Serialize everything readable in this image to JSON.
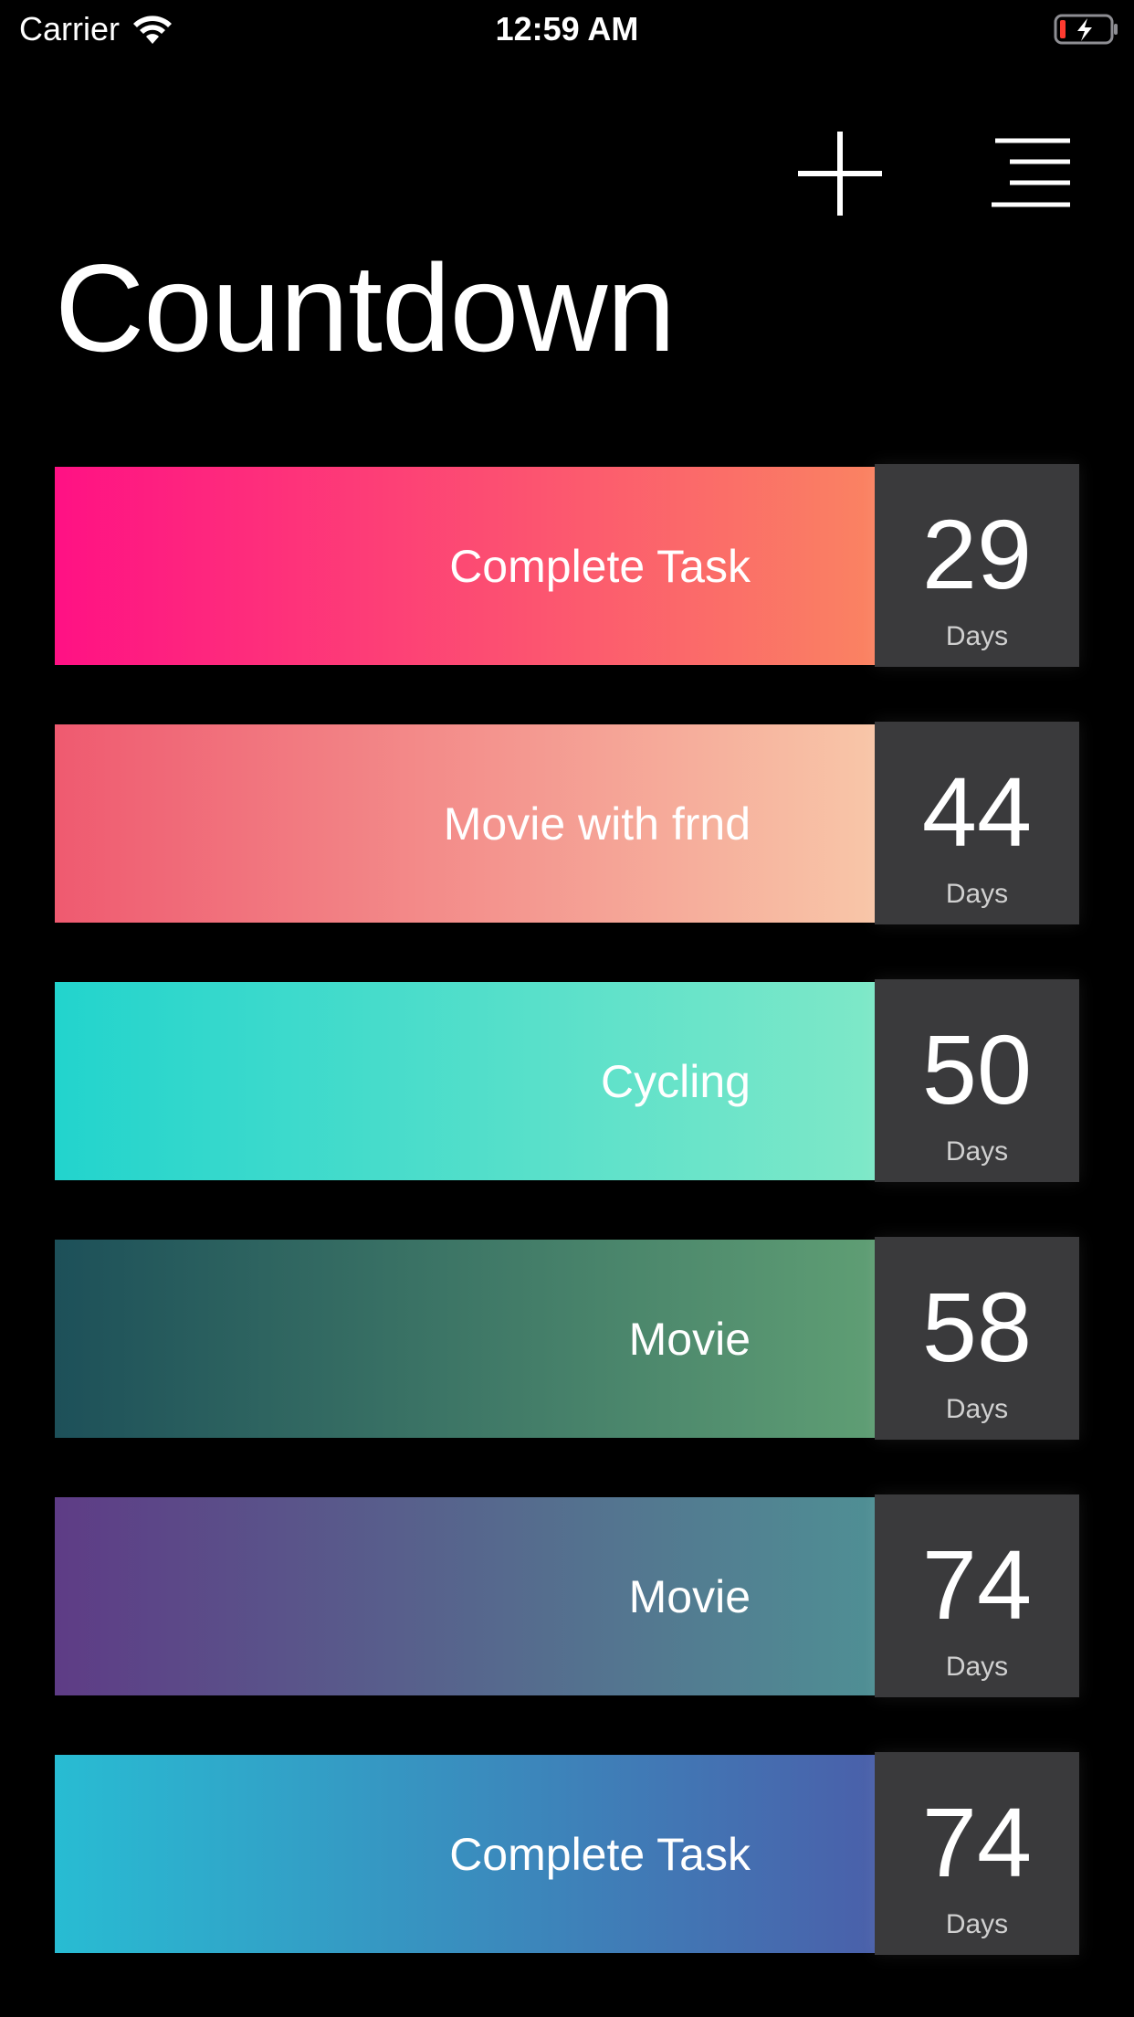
{
  "status_bar": {
    "carrier": "Carrier",
    "time": "12:59 AM",
    "icons": [
      "wifi-icon",
      "battery-charging-icon"
    ]
  },
  "toolbar": {
    "add_icon": "plus-icon",
    "menu_icon": "menu-icon"
  },
  "title": "Countdown",
  "unit_label": "Days",
  "items": [
    {
      "title": "Complete Task",
      "days": "29",
      "gradient": [
        "#ff1184",
        "#fa8362"
      ]
    },
    {
      "title": "Movie with frnd",
      "days": "44",
      "gradient": [
        "#ef5a70",
        "#f8c6a8"
      ]
    },
    {
      "title": "Cycling",
      "days": "50",
      "gradient": [
        "#22d4cd",
        "#7ee8c8"
      ]
    },
    {
      "title": "Movie",
      "days": "58",
      "gradient": [
        "#1d5059",
        "#5f9e74"
      ]
    },
    {
      "title": "Movie",
      "days": "74",
      "gradient": [
        "#5e3c86",
        "#4f8f94"
      ]
    },
    {
      "title": "Complete Task",
      "days": "74",
      "gradient": [
        "#28bcd3",
        "#4a60aa"
      ]
    }
  ],
  "colors": {
    "background": "#000000",
    "counter_box": "#3a3a3c",
    "battery_low": "#ff3b30"
  }
}
